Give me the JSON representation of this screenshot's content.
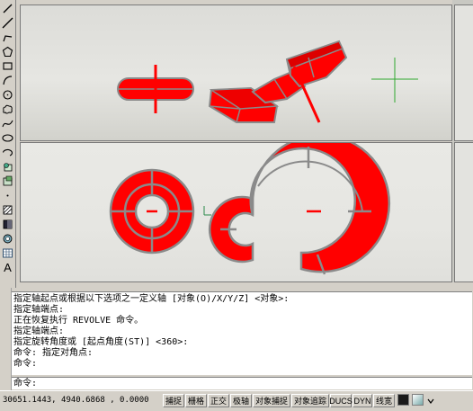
{
  "toolbar": {
    "tools": [
      {
        "name": "line-icon"
      },
      {
        "name": "construction-line-icon"
      },
      {
        "name": "polyline-icon"
      },
      {
        "name": "polygon-icon"
      },
      {
        "name": "rectangle-icon"
      },
      {
        "name": "arc-icon"
      },
      {
        "name": "circle-icon"
      },
      {
        "name": "revision-cloud-icon"
      },
      {
        "name": "spline-icon"
      },
      {
        "name": "ellipse-icon"
      },
      {
        "name": "ellipse-arc-icon"
      },
      {
        "name": "insert-block-icon"
      },
      {
        "name": "make-block-icon"
      },
      {
        "name": "point-icon"
      },
      {
        "name": "hatch-icon"
      },
      {
        "name": "gradient-icon"
      },
      {
        "name": "region-icon"
      },
      {
        "name": "table-icon"
      },
      {
        "name": "multiline-text-icon"
      }
    ],
    "text_tool_label": "A"
  },
  "command": {
    "history": [
      "指定轴起点或根据以下选项之一定义轴 [对象(O)/X/Y/Z] <对象>:",
      "指定轴端点:",
      "正在恢复执行 REVOLVE 命令。",
      "指定轴端点:",
      "指定旋转角度或 [起点角度(ST)] <360>:",
      "命令: 指定对角点:",
      "命令:"
    ],
    "prompt": "命令:"
  },
  "status": {
    "coordinates": "30651.1443, 4940.6868 , 0.0000",
    "buttons": [
      "捕捉",
      "栅格",
      "正交",
      "极轴",
      "对象捕捉",
      "对象追踪",
      "DUCS",
      "DYN",
      "线宽"
    ]
  },
  "colors": {
    "solid": "#ff0000",
    "edge": "#8a8a8a",
    "crosshair": "#2ea82e"
  }
}
